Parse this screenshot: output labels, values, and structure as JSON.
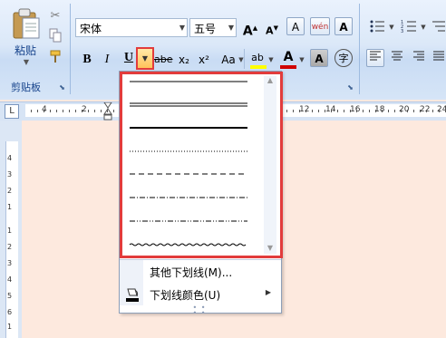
{
  "clipboard": {
    "paste_label": "粘贴",
    "group_label": "剪贴板"
  },
  "font": {
    "font_name": "宋体",
    "font_size": "五号",
    "grow_label": "A",
    "shrink_label": "A",
    "clear_format_label": "A",
    "phonetic_label": "wén",
    "border_char_label": "A",
    "bold_label": "B",
    "italic_label": "I",
    "underline_label": "U",
    "strike_label": "abe",
    "subscript_label": "x₂",
    "superscript_label": "x²",
    "case_label": "Aa",
    "highlight_label": "ab",
    "font_color_label": "A",
    "char_shading_label": "A",
    "enclose_label": "字"
  },
  "ruler": {
    "tab_selector": "L",
    "left_marks": [
      "4",
      "2"
    ],
    "right_marks": [
      "12",
      "14",
      "16",
      "18",
      "20",
      "22",
      "24"
    ],
    "vertical_marks": [
      "4",
      "3",
      "2",
      "1",
      "1",
      "2",
      "3",
      "4",
      "5",
      "6",
      "1",
      "3"
    ]
  },
  "underline_menu": {
    "line_styles": [
      "single",
      "double",
      "thick",
      "dotted",
      "dashed",
      "dash-dot",
      "dash-dot-dot",
      "wavy"
    ],
    "more_label": "其他下划线(M)...",
    "color_label": "下划线颜色(U)"
  },
  "colors": {
    "highlight_box": "#e23c3c",
    "page_background": "#fde9de",
    "ribbon_blue": "#dbe8f8",
    "font_color_bar": "#d00000",
    "highlight_bar": "#ffff00"
  }
}
